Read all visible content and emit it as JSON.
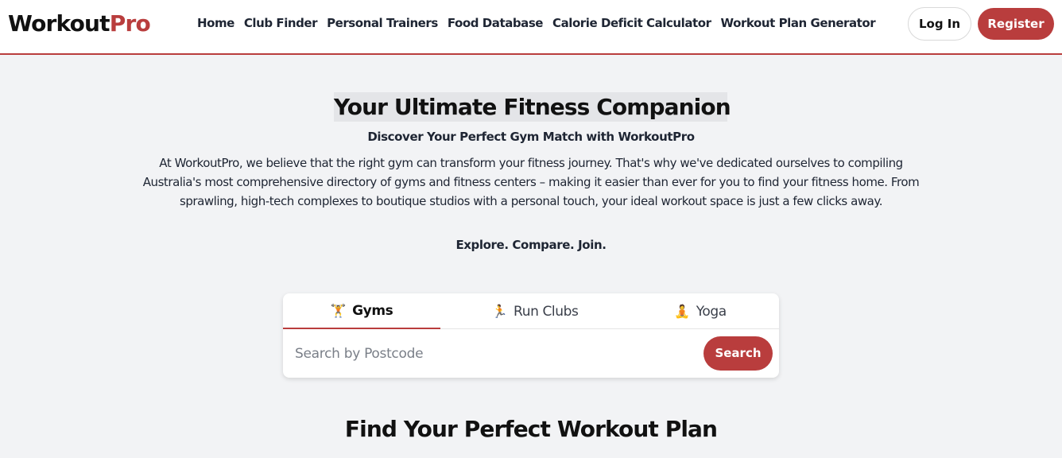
{
  "brand": {
    "name_part1": "Workout",
    "name_part2": "Pro",
    "accent_color": "#b93d3d"
  },
  "nav": {
    "items": [
      {
        "label": "Home"
      },
      {
        "label": "Club Finder"
      },
      {
        "label": "Personal Trainers"
      },
      {
        "label": "Food Database"
      },
      {
        "label": "Calorie Deficit Calculator"
      },
      {
        "label": "Workout Plan Generator"
      }
    ]
  },
  "auth": {
    "login_label": "Log In",
    "register_label": "Register"
  },
  "hero": {
    "title": "Your Ultimate Fitness Companion",
    "subtitle": "Discover Your Perfect Gym Match with WorkoutPro",
    "body": "At WorkoutPro, we believe that the right gym can transform your fitness journey. That's why we've dedicated ourselves to compiling Australia's most comprehensive directory of gyms and fitness centers – making it easier than ever for you to find your fitness home. From sprawling, high-tech complexes to boutique studios with a personal touch, your ideal workout space is just a few clicks away.",
    "tagline": "Explore. Compare. Join."
  },
  "search": {
    "tabs": [
      {
        "label": "Gyms",
        "icon": "🏋️",
        "icon_name": "weightlifter-icon",
        "active": true
      },
      {
        "label": "Run Clubs",
        "icon": "🏃",
        "icon_name": "runner-icon",
        "active": false
      },
      {
        "label": "Yoga",
        "icon": "🧘",
        "icon_name": "yoga-icon",
        "active": false
      }
    ],
    "placeholder": "Search by Postcode",
    "value": "",
    "button_label": "Search"
  },
  "section": {
    "title": "Find Your Perfect Workout Plan"
  }
}
